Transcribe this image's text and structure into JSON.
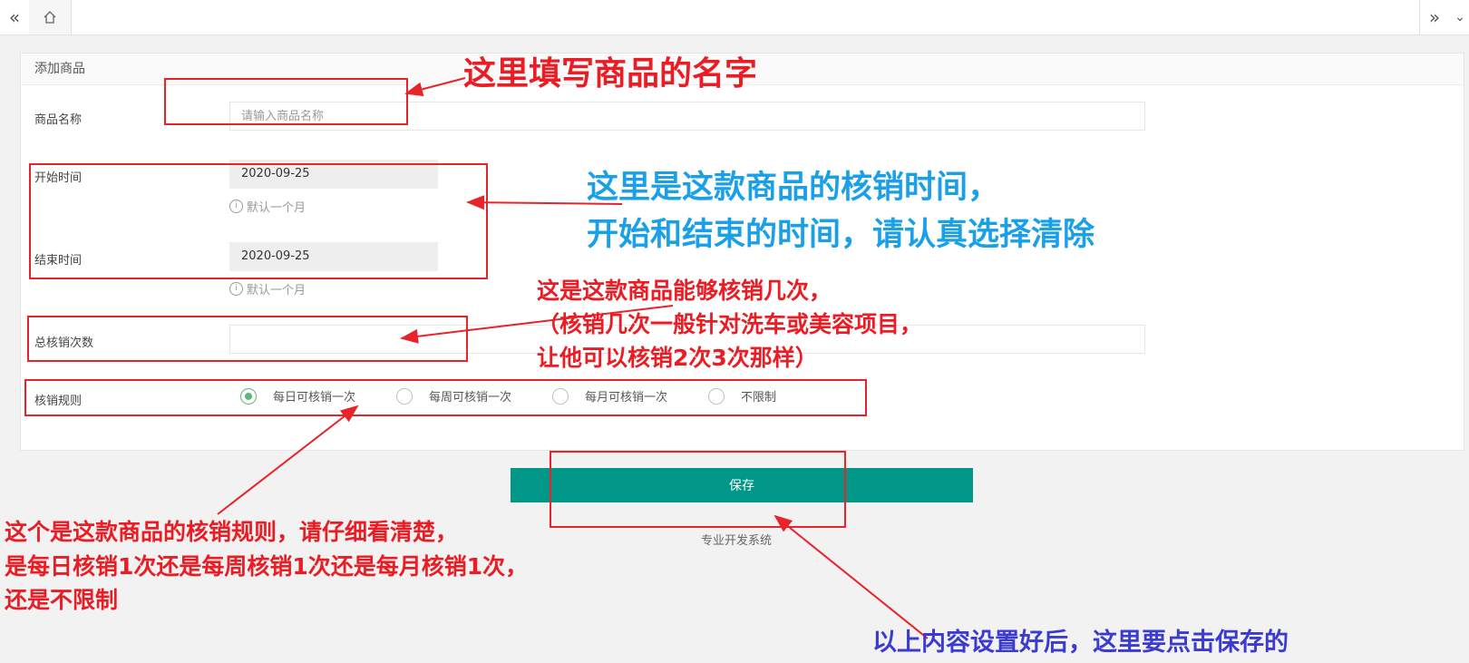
{
  "colors": {
    "primary": "#009688",
    "radio_checked": "#5fb878",
    "annotation_red": "#ea1c24",
    "annotation_blue": "#1aa0e8",
    "annotation_purple": "#3b3bd0"
  },
  "topbar": {
    "left_icon": "double-chevron-left-icon",
    "home_icon": "home-icon",
    "right_icon": "double-chevron-right-icon",
    "down_icon": "chevron-down-icon"
  },
  "form": {
    "title": "添加商品",
    "name_label": "商品名称",
    "name_placeholder": "请输入商品名称",
    "start_label": "开始时间",
    "start_value": "2020-09-25",
    "start_hint": "默认一个月",
    "end_label": "结束时间",
    "end_value": "2020-09-25",
    "end_hint": "默认一个月",
    "count_label": "总核销次数",
    "count_value": "",
    "rule_label": "核销规则",
    "rule_options": [
      "每日可核销一次",
      "每周可核销一次",
      "每月可核销一次",
      "不限制"
    ],
    "rule_selected": "每日可核销一次",
    "save_label": "保存",
    "footer": "专业开发系统"
  },
  "annotations": {
    "name": "这里填写商品的名字",
    "time_line1": "这里是这款商品的核销时间，",
    "time_line2": "开始和结束的时间，请认真选择清除",
    "count_line1": "这是这款商品能够核销几次，",
    "count_line2": "（核销几次一般针对洗车或美容项目，",
    "count_line3": "让他可以核销2次3次那样）",
    "rule_line1": "这个是这款商品的核销规则，请仔细看清楚，",
    "rule_line2": "是每日核销1次还是每周核销1次还是每月核销1次，",
    "rule_line3": "还是不限制",
    "save": "以上内容设置好后，这里要点击保存的"
  }
}
